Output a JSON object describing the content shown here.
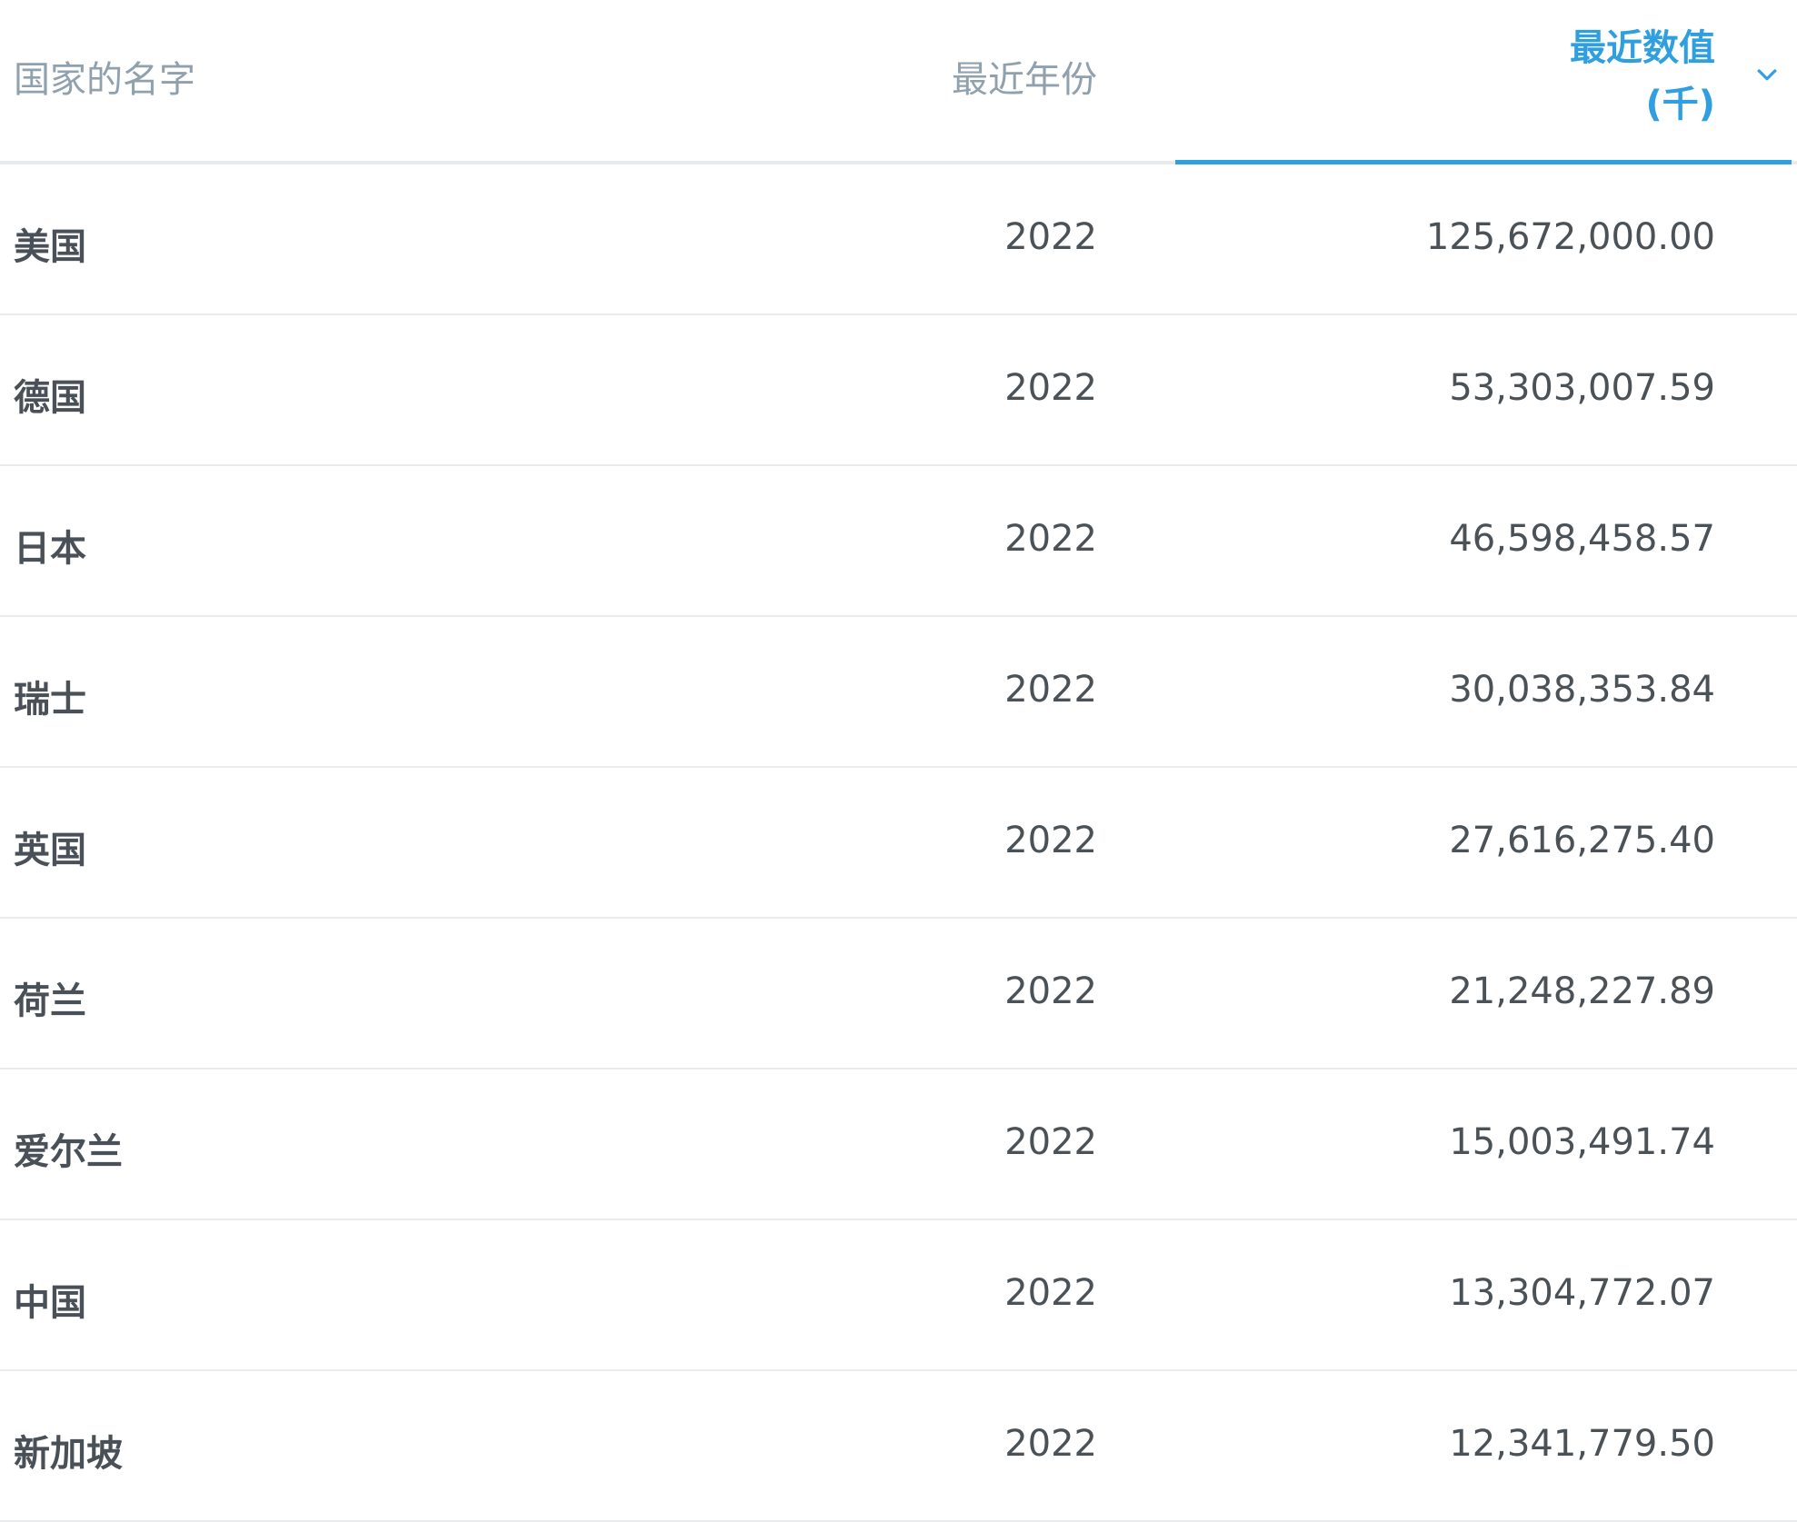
{
  "header": {
    "country_label": "国家的名字",
    "year_label": "最近年份",
    "value_label_line1": "最近数值",
    "value_label_line2": "(千)",
    "sort_icon": "chevron-down-icon",
    "accent_color": "#2f9fe0"
  },
  "rows": [
    {
      "country": "美国",
      "year": "2022",
      "value": "125,672,000.00"
    },
    {
      "country": "德国",
      "year": "2022",
      "value": "53,303,007.59"
    },
    {
      "country": "日本",
      "year": "2022",
      "value": "46,598,458.57"
    },
    {
      "country": "瑞士",
      "year": "2022",
      "value": "30,038,353.84"
    },
    {
      "country": "英国",
      "year": "2022",
      "value": "27,616,275.40"
    },
    {
      "country": "荷兰",
      "year": "2022",
      "value": "21,248,227.89"
    },
    {
      "country": "爱尔兰",
      "year": "2022",
      "value": "15,003,491.74"
    },
    {
      "country": "中国",
      "year": "2022",
      "value": "13,304,772.07"
    },
    {
      "country": "新加坡",
      "year": "2022",
      "value": "12,341,779.50"
    }
  ]
}
